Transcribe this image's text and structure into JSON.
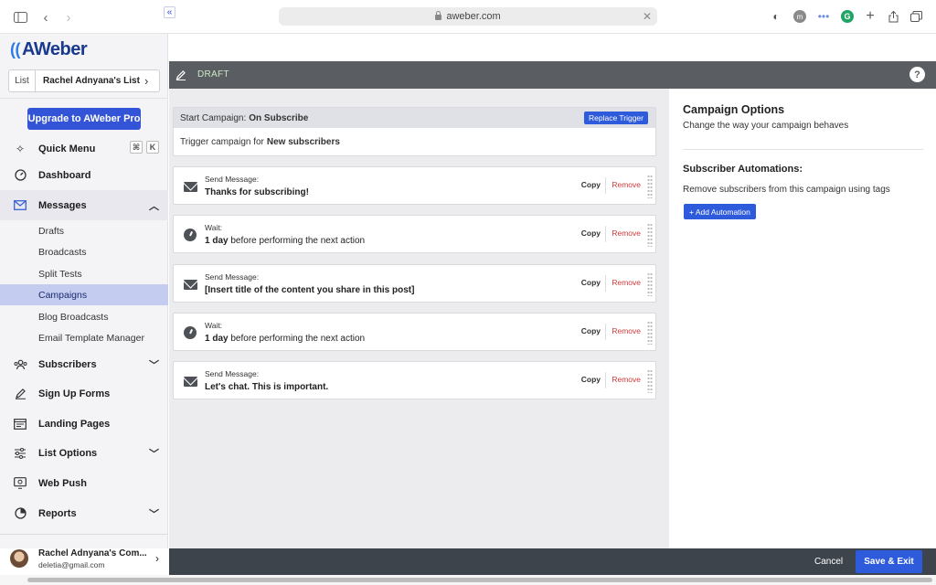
{
  "browser": {
    "url": "aweber.com"
  },
  "sidebar": {
    "logo": "AWeber",
    "list_label": "List",
    "list_name": "Rachel Adnyana's List",
    "upgrade_label": "Upgrade to AWeber Pro",
    "quick_menu": {
      "label": "Quick Menu",
      "key1": "⌘",
      "key2": "K"
    },
    "nav": {
      "dashboard": "Dashboard",
      "messages": "Messages",
      "subscribers": "Subscribers",
      "signup_forms": "Sign Up Forms",
      "landing_pages": "Landing Pages",
      "list_options": "List Options",
      "web_push": "Web Push",
      "reports": "Reports"
    },
    "messages_sub": [
      "Drafts",
      "Broadcasts",
      "Split Tests",
      "Campaigns",
      "Blog Broadcasts",
      "Email Template Manager"
    ],
    "account": {
      "name": "Rachel Adnyana's Com...",
      "email": "deletia@gmail.com"
    }
  },
  "header": {
    "status": "DRAFT",
    "help": "?"
  },
  "trigger": {
    "prefix": "Start Campaign:",
    "event": "On Subscribe",
    "replace_label": "Replace Trigger",
    "body_prefix": "Trigger campaign for",
    "body_target": "New subscribers"
  },
  "steps": [
    {
      "type": "message",
      "label": "Send Message:",
      "title": "Thanks for subscribing!",
      "title_suffix": ""
    },
    {
      "type": "wait",
      "label": "Wait:",
      "title": "1 day",
      "title_suffix": "before performing the next action"
    },
    {
      "type": "message",
      "label": "Send Message:",
      "title": "[Insert title of the content you share in this post]",
      "title_suffix": ""
    },
    {
      "type": "wait",
      "label": "Wait:",
      "title": "1 day",
      "title_suffix": "before performing the next action"
    },
    {
      "type": "message",
      "label": "Send Message:",
      "title": "Let's chat. This is important.",
      "title_suffix": ""
    }
  ],
  "step_actions": {
    "copy": "Copy",
    "remove": "Remove"
  },
  "options": {
    "title": "Campaign Options",
    "desc": "Change the way your campaign behaves",
    "automations_title": "Subscriber Automations:",
    "automations_desc": "Remove subscribers from this campaign using tags",
    "add_automation": "+ Add Automation"
  },
  "footer": {
    "cancel": "Cancel",
    "save_exit": "Save & Exit"
  },
  "colors": {
    "accent": "#2e5bdb",
    "header_bar": "#5a5d62",
    "footer_bar": "#3e444b",
    "remove": "#d23a3a"
  }
}
